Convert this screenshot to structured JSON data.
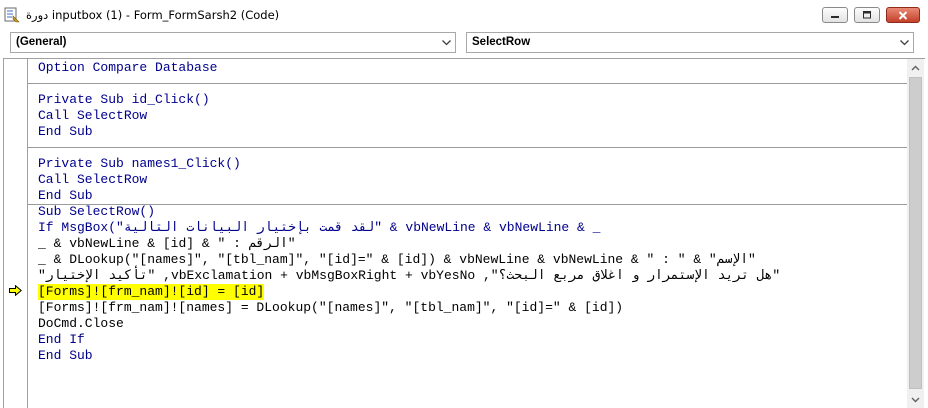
{
  "window": {
    "title": "دورة inputbox (1) - Form_FormSarsh2 (Code)",
    "app_icon": "vba-module-icon"
  },
  "title_buttons": {
    "minimize": "minimize-icon",
    "maximize": "maximize-icon",
    "close": "close-icon"
  },
  "object_combo": {
    "value": "(General)"
  },
  "procedure_combo": {
    "value": "SelectRow"
  },
  "code": {
    "lines": [
      "Option Compare Database",
      "",
      "Private Sub id_Click()",
      "Call SelectRow",
      "End Sub",
      "",
      "Private Sub names1_Click()",
      "Call SelectRow",
      "End Sub",
      "Sub SelectRow()",
      "If MsgBox(\"لقد قمت بإختيار البيانات التالية\" & vbNewLine & vbNewLine & _",
      "               \"الرقم : \" & [id] & vbNewLine & _",
      "               \"الإسم\" & \" : \" & DLookup(\"[names]\", \"[tbl_nam]\", \"[id]=\" & [id]) & vbNewLine & vbNewLine & _",
      "               \"هل تريد الإستمرار و اغلاق مربع البحث؟\", vbExclamation + vbMsgBoxRight + vbYesNo, \"تأكيد الإختيار\"",
      "[Forms]![frm_nam]![id] = [id]",
      "[Forms]![frm_nam]![names] = DLookup(\"[names]\", \"[tbl_nam]\", \"[id]=\" & [id])",
      "DoCmd.Close",
      "End If",
      "End Sub"
    ],
    "current_line": 15,
    "highlight_color": "#ffff00",
    "keyword_color": "#00008b"
  },
  "margin": {
    "execution_marker": "execution-pointer-arrow-icon"
  },
  "scrollbar": {
    "up": "scroll-up-arrow-icon",
    "down": "scroll-down-arrow-icon"
  }
}
